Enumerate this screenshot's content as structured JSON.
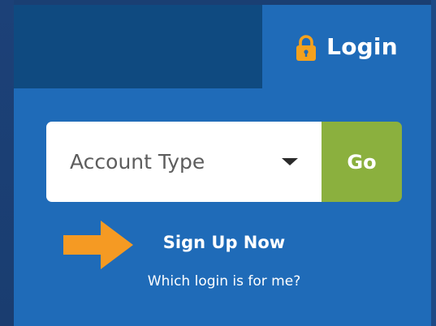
{
  "header": {
    "login_label": "Login",
    "lock_icon": "padlock-icon"
  },
  "form": {
    "account_type_placeholder": "Account Type",
    "caret_icon": "chevron-down-icon",
    "go_label": "Go"
  },
  "links": {
    "sign_up": "Sign Up Now",
    "which_login": "Which login is for me?"
  },
  "colors": {
    "panel": "#1f6bb8",
    "dark_tab": "#0f4a80",
    "go_button": "#8bb03e",
    "lock": "#f4a11d",
    "arrow": "#f59a23"
  }
}
